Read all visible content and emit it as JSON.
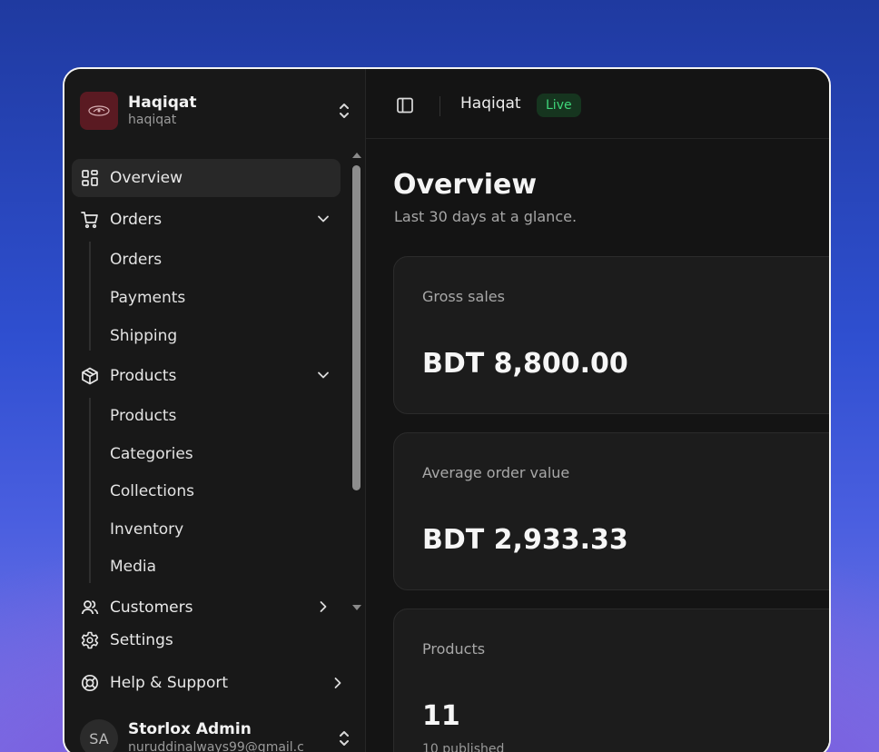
{
  "store": {
    "name": "Haqiqat",
    "handle": "haqiqat"
  },
  "nav": {
    "overview": "Overview",
    "orders": {
      "label": "Orders",
      "children": [
        "Orders",
        "Payments",
        "Shipping"
      ]
    },
    "products": {
      "label": "Products",
      "children": [
        "Products",
        "Categories",
        "Collections",
        "Inventory",
        "Media"
      ]
    },
    "customers": "Customers"
  },
  "bottom": {
    "settings": "Settings",
    "help": "Help & Support"
  },
  "user": {
    "initials": "SA",
    "name": "Storlox Admin",
    "email": "nuruddinalways99@gmail.c"
  },
  "topbar": {
    "crumb": "Haqiqat",
    "badge": "Live"
  },
  "page": {
    "title": "Overview",
    "subtitle": "Last 30 days at a glance."
  },
  "cards": [
    {
      "label": "Gross sales",
      "value": "BDT 8,800.00"
    },
    {
      "label": "Average order value",
      "value": "BDT 2,933.33"
    },
    {
      "label": "Products",
      "value": "11",
      "foot": "10 published"
    }
  ],
  "colors": {
    "accent_live": "#3fd77a",
    "active_bg": "#282828"
  }
}
